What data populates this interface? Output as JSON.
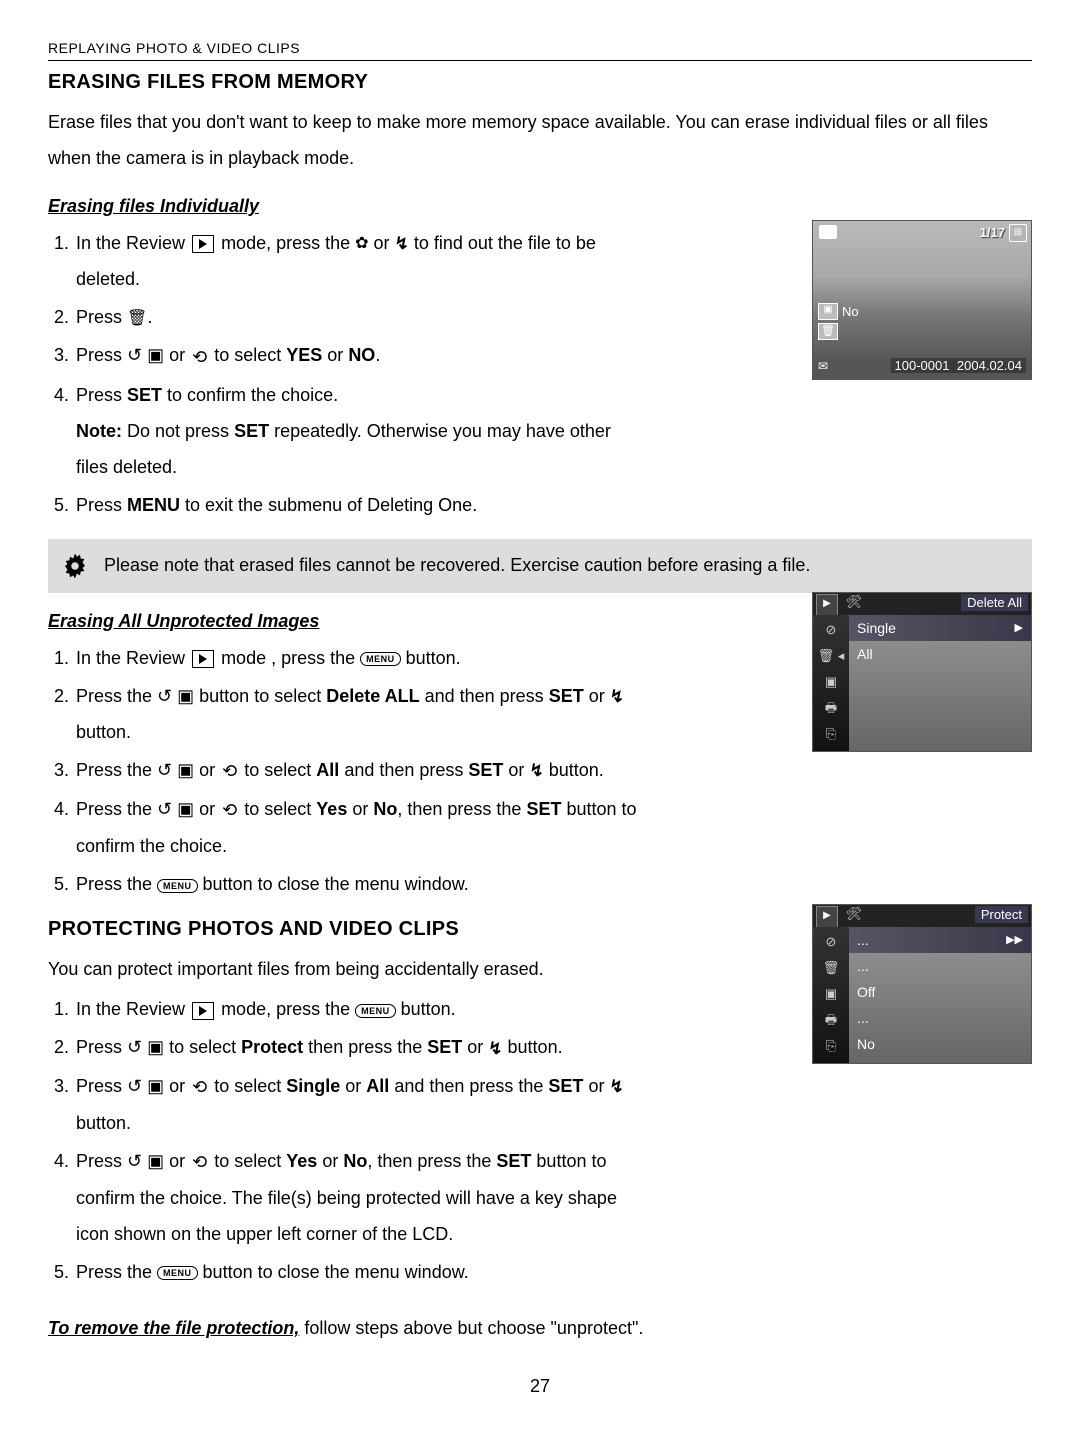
{
  "header": "REPLAYING PHOTO & VIDEO CLIPS",
  "section1": {
    "title": "ERASING FILES FROM MEMORY",
    "intro": "Erase files that you don't want to keep to make more memory space available. You can erase individual files or all files when the camera is in playback mode."
  },
  "sub1": {
    "title": "Erasing files Individually",
    "s1a": "In the Review ",
    "s1b": " mode, press the ",
    "s1c": " or ",
    "s1d": " to find out the file to be deleted.",
    "s2a": "Press ",
    "s2b": ".",
    "s3a": "Press ",
    "s3b": " or ",
    "s3c": " to select ",
    "s3d": "YES",
    "s3e": " or ",
    "s3f": "NO",
    "s3g": ".",
    "s4a": "Press ",
    "s4b": "SET",
    "s4c": " to confirm the choice.",
    "s4_note_a": "Note:",
    "s4_note_b": " Do not press ",
    "s4_note_c": "SET",
    "s4_note_d": " repeatedly. Otherwise you may have other files deleted.",
    "s5a": "Press ",
    "s5b": "MENU",
    "s5c": " to exit the submenu of Deleting One."
  },
  "callout": "Please note that erased files cannot be recovered. Exercise caution before erasing a file.",
  "sub2": {
    "title": "Erasing All Unprotected Images",
    "s1a": "In the Review ",
    "s1b": " mode , press the ",
    "s1c": " button.",
    "s2a": "Press the ",
    "s2b": " button to select ",
    "s2c": "Delete ALL",
    "s2d": " and then press ",
    "s2e": "SET",
    "s2f": " or ",
    "s2g": " button.",
    "s3a": "Press the ",
    "s3b": " or ",
    "s3c": " to select ",
    "s3d": "All",
    "s3e": " and then press ",
    "s3f": "SET",
    "s3g": " or ",
    "s3h": " button.",
    "s4a": "Press the ",
    "s4b": " or ",
    "s4c": " to select ",
    "s4d": "Yes",
    "s4e": " or ",
    "s4f": "No",
    "s4g": ", then press the ",
    "s4h": "SET",
    "s4i": " button to confirm the choice.",
    "s5a": "Press the ",
    "s5b": " button to close the menu window."
  },
  "section2": {
    "title": "PROTECTING PHOTOS AND VIDEO CLIPS",
    "intro": "You can protect important files from being accidentally erased.",
    "s1a": "In the Review ",
    "s1b": " mode, press the ",
    "s1c": " button.",
    "s2a": "Press ",
    "s2b": " to select ",
    "s2c": "Protect",
    "s2d": " then press the ",
    "s2e": "SET",
    "s2f": " or ",
    "s2g": " button.",
    "s3a": "Press ",
    "s3b": " or ",
    "s3c": " to select ",
    "s3d": "Single",
    "s3e": " or ",
    "s3f": "All",
    "s3g": " and then press the ",
    "s3h": "SET",
    "s3i": " or ",
    "s3j": " button.",
    "s4a": "Press ",
    "s4b": " or ",
    "s4c": " to select ",
    "s4d": "Yes",
    "s4e": " or ",
    "s4f": "No",
    "s4g": ", then press the ",
    "s4h": "SET",
    "s4i": " button to confirm the choice. The file(s) being protected will have a key shape icon shown on the upper left corner of the LCD.",
    "s5a": "Press the ",
    "s5b": " button to close the menu window."
  },
  "remove": {
    "lead": "To remove the file protection,",
    "tail": " follow steps above but choose \"unprotect\"."
  },
  "menu_label": "MENU",
  "page_number": "27",
  "lcd1": {
    "counter": "1/17",
    "no": "No",
    "filenum": "100-0001",
    "date": "2004.02.04"
  },
  "lcd2": {
    "title": "Delete All",
    "single": "Single",
    "all": "All"
  },
  "lcd3": {
    "title": "Protect",
    "r1": "...",
    "r2": "...",
    "r3": "Off",
    "r4": "...",
    "r5": "No"
  }
}
